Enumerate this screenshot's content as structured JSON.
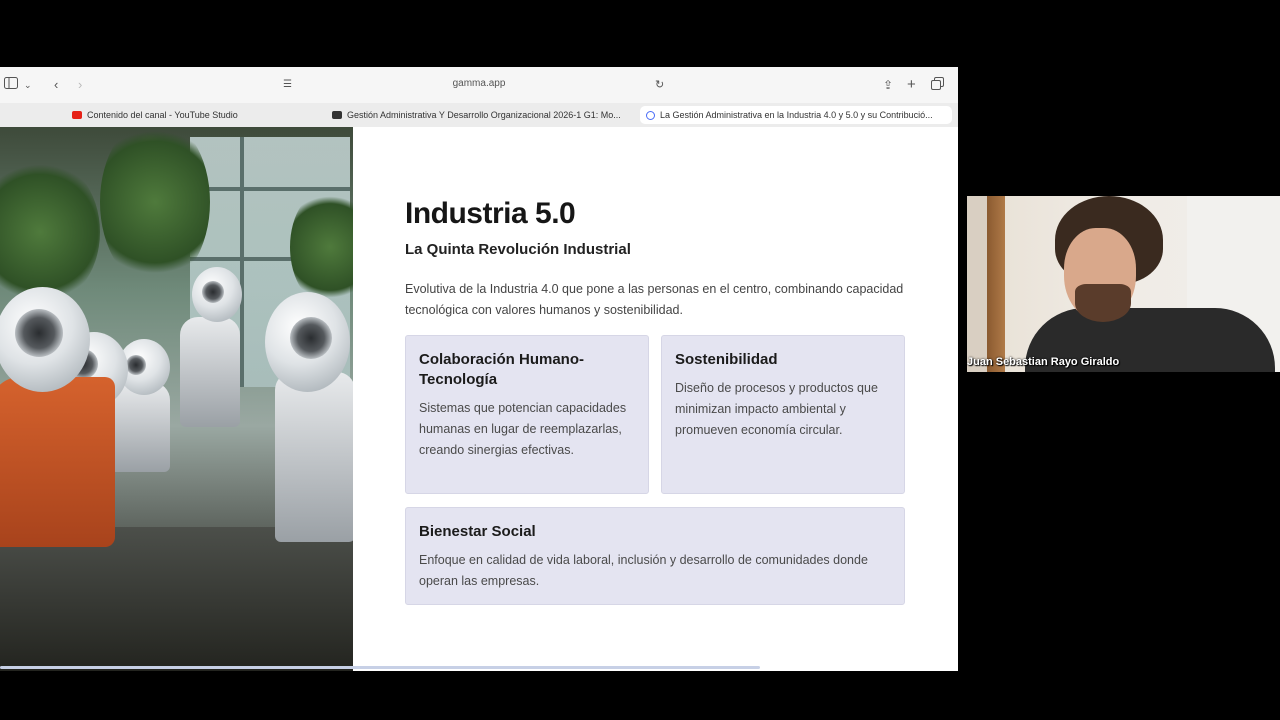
{
  "browser": {
    "url": "gamma.app",
    "tabs": [
      {
        "label": "Contenido del canal - YouTube Studio",
        "favicon": "youtube-icon",
        "active": false
      },
      {
        "label": "Gestión Administrativa Y Desarrollo Organizacional 2026-1 G1: Mo...",
        "favicon": "moodle-icon",
        "active": false
      },
      {
        "label": "La Gestión Administrativa en la Industria 4.0 y 5.0 y su Contribució...",
        "favicon": "gamma-icon",
        "active": true
      }
    ],
    "icons": {
      "sidebar": "sidebar-icon",
      "back": "chevron-left-icon",
      "forward": "chevron-right-icon",
      "reader": "reader-icon",
      "reload": "reload-icon",
      "share": "share-icon",
      "new_tab": "plus-icon",
      "tabs_overview": "tabs-icon"
    }
  },
  "slide": {
    "title": "Industria 5.0",
    "subtitle": "La Quinta Revolución Industrial",
    "description": "Evolutiva de la Industria 4.0 que pone a las personas en el centro, combinando capacidad tecnológica con valores humanos y sostenibilidad.",
    "cards": [
      {
        "title": "Colaboración Humano-Tecnología",
        "text": "Sistemas que potencian capacidades humanas en lugar de reemplazarlas, creando sinergias efectivas."
      },
      {
        "title": "Sostenibilidad",
        "text": "Diseño de procesos y productos que minimizan impacto ambiental y promueven economía circular."
      },
      {
        "title": "Bienestar Social",
        "text": "Enfoque en calidad de vida laboral, inclusión y desarrollo de comunidades donde operan las empresas."
      }
    ],
    "card_color": "#e4e4f1"
  },
  "webcam": {
    "participant_name": "Juan Sebastian Rayo Giraldo"
  }
}
